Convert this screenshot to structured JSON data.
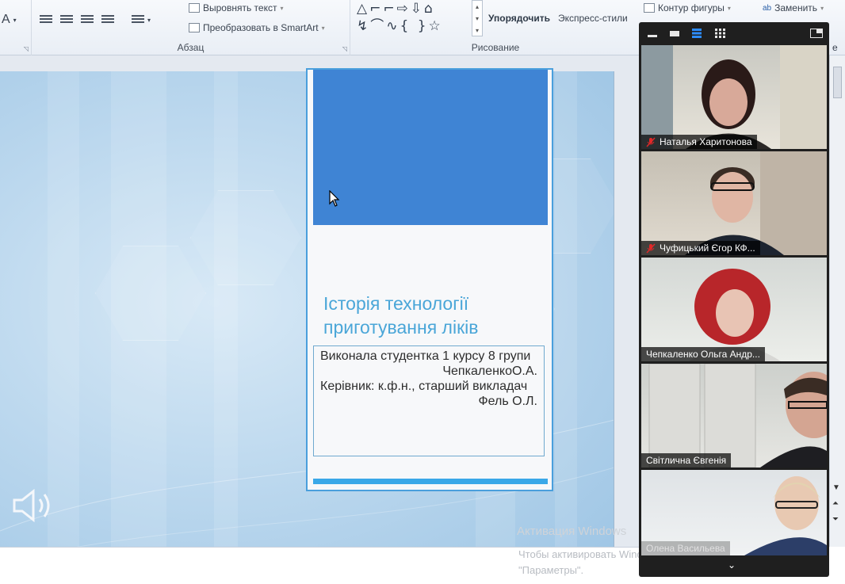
{
  "ribbon": {
    "align_text": "Выровнять текст",
    "convert_smartart": "Преобразовать в SmartArt",
    "paragraph_group": "Абзац",
    "arrange": "Упорядочить",
    "quick_styles": "Экспресс-стили",
    "shape_outline": "Контур фигуры",
    "replace": "Заменить",
    "drawing_group": "Рисование",
    "font_letter": "A",
    "editing_group_partial": "е"
  },
  "slide": {
    "title": "Історія технології приготування  ліків",
    "author_line": "Виконала студентка 1 курсу 8 групи",
    "author_name": "ЧепкаленкоО.А.",
    "supervisor_line": "Керівник: к.ф.н., старший викладач",
    "supervisor_name": "Фель О.Л."
  },
  "watermark": {
    "line1": "Активация Windows",
    "line2": "Чтобы активировать Windows, перейдите в раздел",
    "line3": "\"Параметры\"."
  },
  "zoom": {
    "participants": [
      {
        "name": "Наталья Харитонова",
        "muted": true
      },
      {
        "name": "Чуфицький Єгор КФ...",
        "muted": true
      },
      {
        "name": "Чепкаленко Ольга Андр...",
        "muted": false
      },
      {
        "name": "Світлична Євгенія",
        "muted": false
      },
      {
        "name": "Олена Васильева",
        "muted": false
      }
    ]
  },
  "colors": {
    "slide_blue": "#3f84d4",
    "title_cyan": "#4aa6d8",
    "zoom_bg": "#1f1f1f"
  }
}
